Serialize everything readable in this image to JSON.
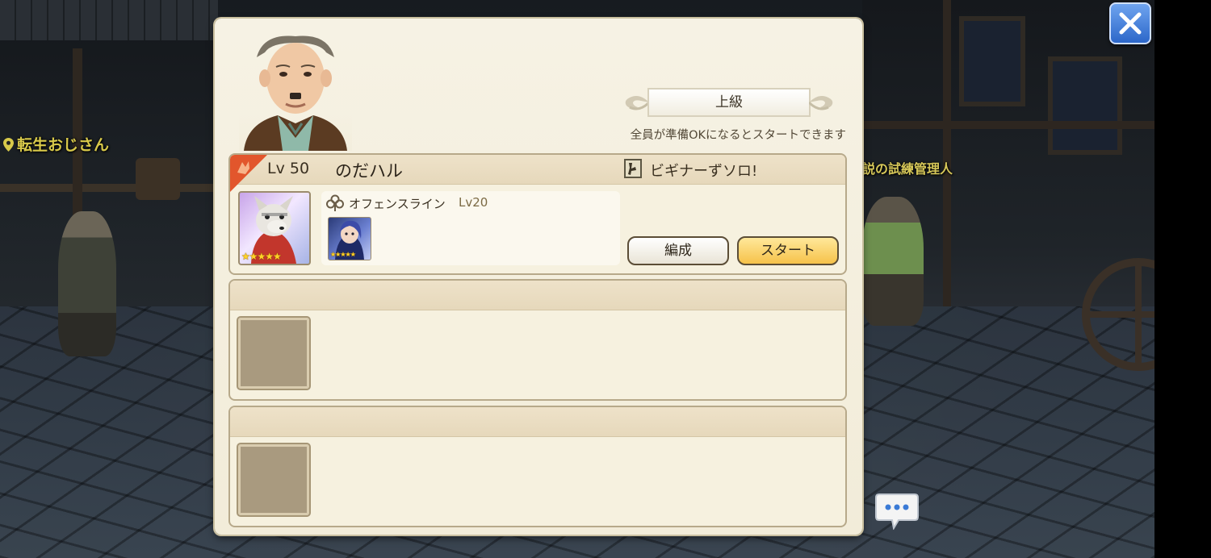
{
  "background": {
    "npc_left_name": "転生おじさん",
    "npc_right_name": "説の試練管理人"
  },
  "panel": {
    "difficulty": "上級",
    "ready_message": "全員が準備OKになるとスタートできます",
    "slots": [
      {
        "player_level": "Lv 50",
        "player_name": "のだハル",
        "title": "ビギナーずソロ!",
        "main_unit_stars": "★★★★★",
        "sub_type": "オフェンスライン",
        "sub_level": "Lv20",
        "sub_unit_stars": "★★★★★",
        "formation_label": "編成",
        "start_label": "スタート"
      },
      {
        "empty": true
      },
      {
        "empty": true
      }
    ]
  },
  "colors": {
    "panel_bg": "#f6f2e4",
    "slot_header": "#e8dbbf",
    "start_button": "#f6c24a",
    "leader_badge": "#e2562c",
    "close_button": "#2c67c9",
    "npc_name": "#d8c94a"
  },
  "icons": {
    "close": "close-icon",
    "chat": "chat-bubble-icon",
    "leader": "leader-badge-icon",
    "title": "title-badge-icon",
    "sub_type": "clover-icon",
    "npc_marker": "pin-icon"
  }
}
